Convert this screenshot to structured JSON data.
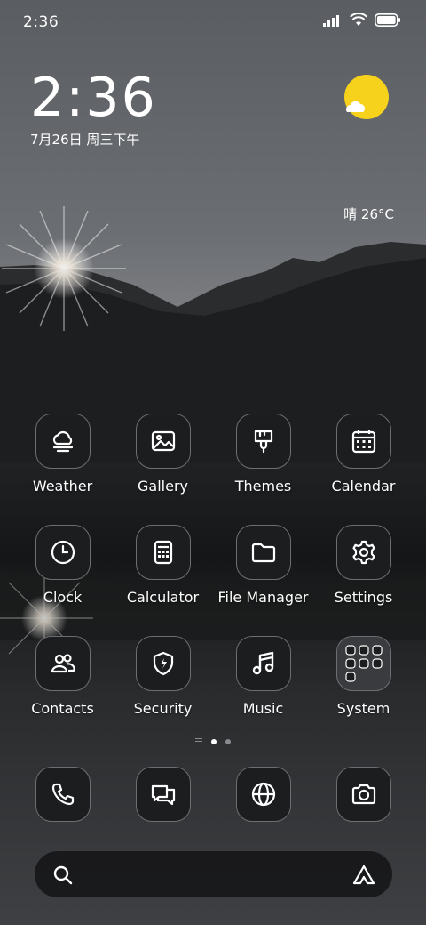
{
  "status_bar": {
    "time": "2:36",
    "icons": [
      "signal-icon",
      "wifi-icon",
      "battery-icon"
    ]
  },
  "clock_widget": {
    "time": "2:36",
    "date": "7月26日 周三下午"
  },
  "weather_widget": {
    "condition_temp": "晴 26°C",
    "icon": "sun-cloud-icon",
    "sun_color": "#f7d21c"
  },
  "apps": [
    {
      "label": "Weather",
      "icon": "weather-cloud-icon"
    },
    {
      "label": "Gallery",
      "icon": "gallery-image-icon"
    },
    {
      "label": "Themes",
      "icon": "paintbrush-icon"
    },
    {
      "label": "Calendar",
      "icon": "calendar-icon"
    },
    {
      "label": "Clock",
      "icon": "clock-icon"
    },
    {
      "label": "Calculator",
      "icon": "calculator-icon"
    },
    {
      "label": "File Manager",
      "icon": "folder-icon"
    },
    {
      "label": "Settings",
      "icon": "gear-icon"
    },
    {
      "label": "Contacts",
      "icon": "contacts-icon"
    },
    {
      "label": "Security",
      "icon": "shield-icon"
    },
    {
      "label": "Music",
      "icon": "music-note-icon"
    },
    {
      "label": "System",
      "icon": "system-folder-icon"
    }
  ],
  "page_indicator": {
    "pages": 2,
    "active": 1
  },
  "dock": [
    {
      "icon": "phone-icon"
    },
    {
      "icon": "messages-icon"
    },
    {
      "icon": "browser-globe-icon"
    },
    {
      "icon": "camera-icon"
    }
  ],
  "search_bar": {
    "left_icon": "search-icon",
    "right_icon": "assistant-icon"
  }
}
